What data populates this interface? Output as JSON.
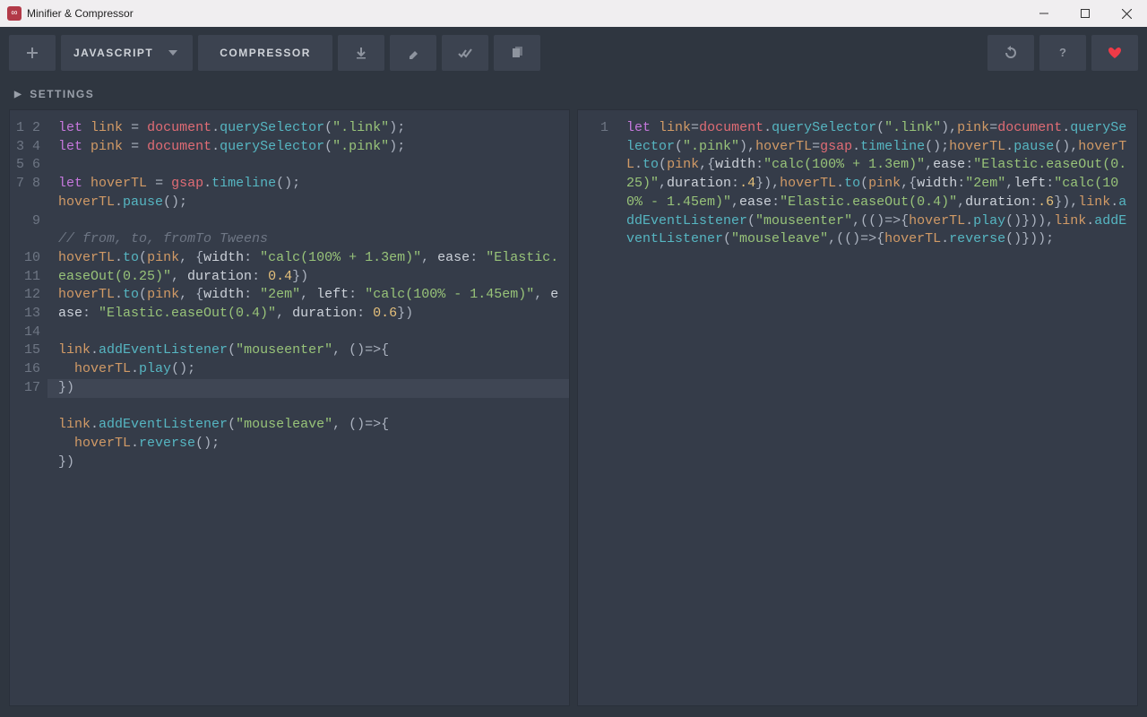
{
  "window": {
    "title": "Minifier & Compressor"
  },
  "toolbar": {
    "language": "JAVASCRIPT",
    "mode": "COMPRESSOR"
  },
  "settings": {
    "label": "SETTINGS"
  },
  "editor_left": {
    "lines": [
      "1",
      "2",
      "3",
      "4",
      "5",
      "6",
      "7",
      "8",
      "9",
      "10",
      "11",
      "12",
      "13",
      "14",
      "15",
      "16",
      "17"
    ],
    "code_plain": "let link = document.querySelector(\".link\");\nlet pink = document.querySelector(\".pink\");\n\nlet hoverTL = gsap.timeline();\nhoverTL.pause();\n\n// from, to, fromTo Tweens\nhoverTL.to(pink, {width: \"calc(100% + 1.3em)\", ease: \"Elastic.easeOut(0.25)\", duration: 0.4})\nhoverTL.to(pink, {width: \"2em\", left: \"calc(100% - 1.45em)\", ease: \"Elastic.easeOut(0.4)\", duration: 0.6})\n\nlink.addEventListener(\"mouseenter\", ()=>{\n  hoverTL.play();\n})\n\nlink.addEventListener(\"mouseleave\", ()=>{\n  hoverTL.reverse();\n})"
  },
  "editor_right": {
    "lines": [
      "1"
    ],
    "code_plain": "let link=document.querySelector(\".link\"),pink=document.querySelector(\".pink\"),hoverTL=gsap.timeline();hoverTL.pause(),hoverTL.to(pink,{width:\"calc(100% + 1.3em)\",ease:\"Elastic.easeOut(0.25)\",duration:.4}),hoverTL.to(pink,{width:\"2em\",left:\"calc(100% - 1.45em)\",ease:\"Elastic.easeOut(0.4)\",duration:.6}),link.addEventListener(\"mouseenter\",(()=>{hoverTL.play()})),link.addEventListener(\"mouseleave\",(()=>{hoverTL.reverse()}));"
  },
  "colors": {
    "bg": "#2f3640",
    "pane": "#353c49",
    "btn": "#3c4350",
    "accent": "#ef3a47"
  }
}
